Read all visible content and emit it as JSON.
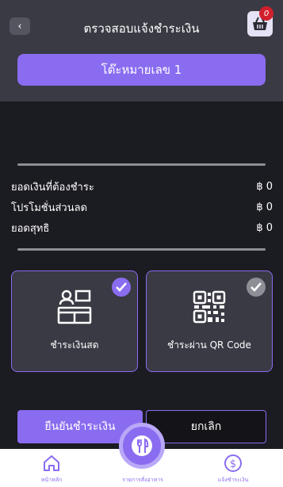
{
  "header": {
    "title": "ตรวจสอบแจ้งชำระเงิน",
    "cart_badge": "0"
  },
  "table_button": "โต๊ะหมายเลข 1",
  "summary": [
    {
      "label": "ยอดเงินที่ต้องชำระ",
      "value": "฿ 0"
    },
    {
      "label": "โปรโมชั่นส่วนลด",
      "value": "฿ 0"
    },
    {
      "label": "ยอดสุทธิ",
      "value": "฿ 0"
    }
  ],
  "payment_methods": [
    {
      "label": "ชำระเงินสด",
      "icon": "cash-register-icon",
      "selected": true
    },
    {
      "label": "ชำระผ่าน QR Code",
      "icon": "qr-code-icon",
      "selected": false
    }
  ],
  "actions": {
    "confirm": "ยืนยันชำระเงิน",
    "cancel": "ยกเลิก"
  },
  "bottom_nav": {
    "home": "หน้าหลัก",
    "orders": "รายการสั่งอาหาร",
    "payment": "แจ้งชำระเงิน"
  },
  "colors": {
    "accent": "#8a6cf0",
    "background": "#1b1b22",
    "header": "#3a3a45",
    "badge": "#d21f2c"
  }
}
